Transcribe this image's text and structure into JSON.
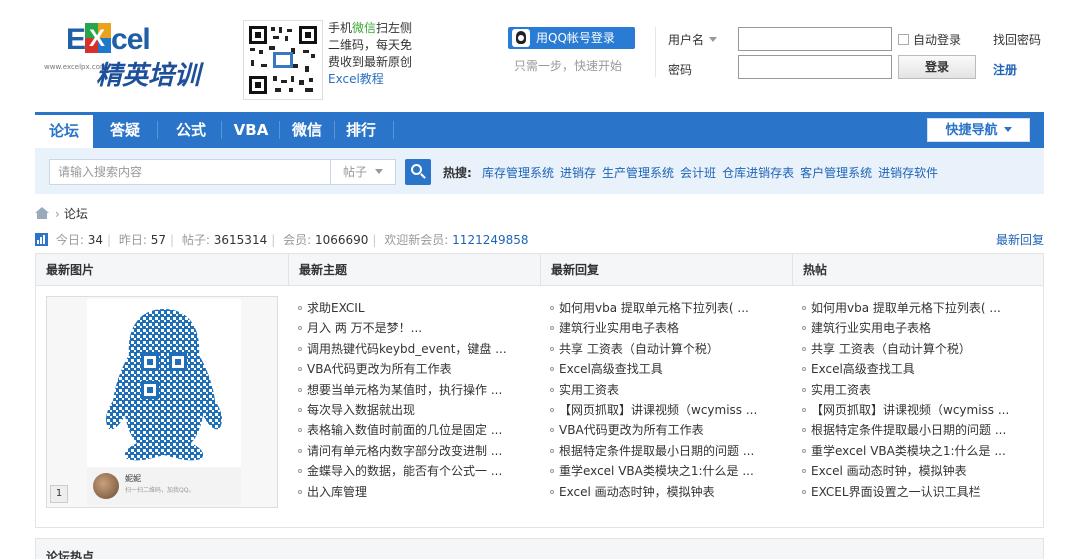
{
  "header": {
    "logo": {
      "brand": "cel",
      "brand_x": "X",
      "brand_e": "E",
      "url": "www.excelpx.com",
      "cn": "精英培训"
    },
    "qr_promo": {
      "line1_pre": "手机",
      "line1_green": "微信",
      "line1_post": "扫左侧",
      "line2": "二维码，每天免",
      "line3": "费收到最新原创",
      "line4_a": "Excel",
      "line4_b": "教程"
    },
    "qq_login_label": "用QQ帐号登录",
    "qq_hint": "只需一步，快速开始",
    "username_label": "用户名",
    "password_label": "密码",
    "auto_login_label": "自动登录",
    "login_button": "登录",
    "find_password": "找回密码",
    "register": "注册"
  },
  "nav": {
    "items": [
      "论坛",
      "答疑",
      "公式",
      "VBA",
      "微信",
      "排行"
    ],
    "quick_nav": "快捷导航"
  },
  "search": {
    "placeholder": "请输入搜索内容",
    "type": "帖子",
    "hot_label": "热搜:",
    "hot_links": [
      "库存管理系统",
      "进销存",
      "生产管理系统",
      "会计班",
      "仓库进销存表",
      "客户管理系统",
      "进销存软件"
    ]
  },
  "breadcrumb": {
    "current": "论坛",
    "sep": "›"
  },
  "stats": {
    "today_label": "今日:",
    "today": "34",
    "yesterday_label": "昨日:",
    "yesterday": "57",
    "posts_label": "帖子:",
    "posts": "3615314",
    "members_label": "会员:",
    "members": "1066690",
    "welcome_label": "欢迎新会员:",
    "welcome": "1121249858",
    "latest_reply_link": "最新回复"
  },
  "panels": {
    "latest_images": {
      "title": "最新图片",
      "profile_name": "妮妮",
      "profile_sub": "扫一扫二维码，加我QQ。",
      "page": "1"
    },
    "latest_topics": {
      "title": "最新主题",
      "items": [
        "求助EXCIL",
        "月入 两 万不是梦！...",
        "调用热键代码keybd_event，键盘 ...",
        "VBA代码更改为所有工作表",
        "想要当单元格为某值时，执行操作 ...",
        "每次导入数据就出现",
        "表格输入数值时前面的几位是固定 ...",
        "请问有单元格内数字部分改变进制 ...",
        "金蝶导入的数据，能否有个公式一 ...",
        "出入库管理"
      ]
    },
    "latest_replies": {
      "title": "最新回复",
      "items": [
        "如何用vba 提取单元格下拉列表( ...",
        "建筑行业实用电子表格",
        "共享 工资表（自动计算个税）",
        "Excel高级查找工具",
        "实用工资表",
        "【网页抓取】讲课视频（wcymiss ...",
        "VBA代码更改为所有工作表",
        "根据特定条件提取最小日期的问题 ...",
        "重学excel VBA类模块之1:什么是 ...",
        "Excel 画动态时钟，模拟钟表"
      ]
    },
    "hot_posts": {
      "title": "热帖",
      "items": [
        "如何用vba 提取单元格下拉列表( ...",
        "建筑行业实用电子表格",
        "共享 工资表（自动计算个税）",
        "Excel高级查找工具",
        "实用工资表",
        "【网页抓取】讲课视频（wcymiss ...",
        "根据特定条件提取最小日期的问题 ...",
        "重学excel VBA类模块之1:什么是 ...",
        "Excel 画动态时钟，模拟钟表",
        "EXCEL界面设置之一认识工具栏"
      ]
    }
  },
  "forum_hot": {
    "title": "论坛热点"
  },
  "colors": {
    "nav_blue": "#2a74c9",
    "link_blue": "#1f63b6"
  }
}
